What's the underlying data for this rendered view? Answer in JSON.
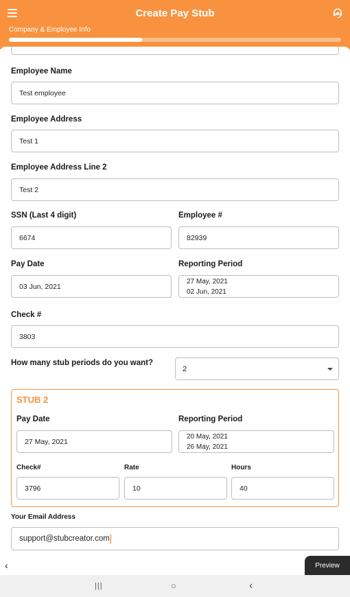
{
  "appbar": {
    "title": "Create Pay Stub",
    "step_label": "Company & Employee Info",
    "progress_fraction": 0.4
  },
  "employee": {
    "name_label": "Employee Name",
    "name_value": "Test employee",
    "address_label": "Employee Address",
    "address_value": "Test 1",
    "address2_label": "Employee Address Line 2",
    "address2_value": "Test 2",
    "ssn_label": "SSN (Last 4 digit)",
    "ssn_value": "6674",
    "number_label": "Employee #",
    "number_value": "82939",
    "pay_date_label": "Pay Date",
    "pay_date_value": "03 Jun, 2021",
    "reporting_period_label": "Reporting Period",
    "reporting_period_start": "27 May, 2021",
    "reporting_period_end": "02 Jun, 2021",
    "check_label": "Check #",
    "check_value": "3803"
  },
  "stub_periods": {
    "label": "How many stub periods do you want?",
    "value": "2"
  },
  "stub2": {
    "title": "STUB 2",
    "pay_date_label": "Pay Date",
    "pay_date_value": "27 May, 2021",
    "reporting_period_label": "Reporting Period",
    "reporting_period_start": "20 May, 2021",
    "reporting_period_end": "26 May, 2021",
    "check_label": "Check#",
    "check_value": "3796",
    "rate_label": "Rate",
    "rate_value": "10",
    "hours_label": "Hours",
    "hours_value": "40"
  },
  "email": {
    "label": "Your Email Address",
    "value": "support@stubcreator.com"
  },
  "bottom": {
    "back_glyph": "‹",
    "preview_label": "Preview"
  },
  "system_nav": {
    "recents_glyph": "|||",
    "home_glyph": "○",
    "back_glyph": "‹"
  },
  "colors": {
    "accent": "#f8923f",
    "preview_bg": "#2b2b2b"
  },
  "icons": [
    "menu-icon",
    "support-agent-icon",
    "chevron-down-icon",
    "back-arrow-icon"
  ]
}
